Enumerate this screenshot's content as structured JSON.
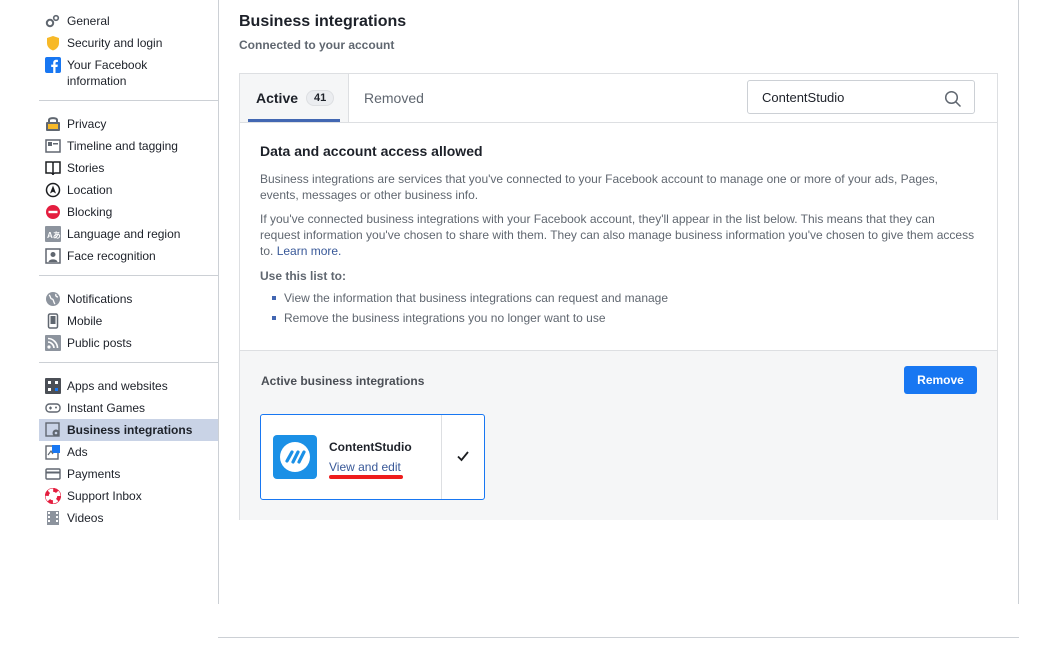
{
  "sidebar": {
    "groups": [
      [
        {
          "label": "General",
          "icon": "gears-icon"
        },
        {
          "label": "Security and login",
          "icon": "shield-icon"
        },
        {
          "label": "Your Facebook information",
          "icon": "facebook-icon"
        }
      ],
      [
        {
          "label": "Privacy",
          "icon": "lock-icon"
        },
        {
          "label": "Timeline and tagging",
          "icon": "timeline-icon"
        },
        {
          "label": "Stories",
          "icon": "book-icon"
        },
        {
          "label": "Location",
          "icon": "location-icon"
        },
        {
          "label": "Blocking",
          "icon": "blocking-icon"
        },
        {
          "label": "Language and region",
          "icon": "language-icon"
        },
        {
          "label": "Face recognition",
          "icon": "face-recognition-icon"
        }
      ],
      [
        {
          "label": "Notifications",
          "icon": "globe-icon"
        },
        {
          "label": "Mobile",
          "icon": "mobile-icon"
        },
        {
          "label": "Public posts",
          "icon": "rss-icon"
        }
      ],
      [
        {
          "label": "Apps and websites",
          "icon": "apps-icon"
        },
        {
          "label": "Instant Games",
          "icon": "gamepad-icon"
        },
        {
          "label": "Business integrations",
          "icon": "business-integrations-icon",
          "active": true
        },
        {
          "label": "Ads",
          "icon": "ads-icon"
        },
        {
          "label": "Payments",
          "icon": "payments-icon"
        },
        {
          "label": "Support Inbox",
          "icon": "lifebuoy-icon"
        },
        {
          "label": "Videos",
          "icon": "film-icon"
        }
      ]
    ]
  },
  "header": {
    "title": "Business integrations",
    "subtitle": "Connected to your account"
  },
  "tabs": {
    "active_label": "Active",
    "active_count": "41",
    "removed_label": "Removed"
  },
  "search": {
    "value": "ContentStudio",
    "icon": "search-icon"
  },
  "info": {
    "heading": "Data and account access allowed",
    "paragraph1": "Business integrations are services that you've connected to your Facebook account to manage one or more of your ads, Pages, events, messages or other business info.",
    "paragraph2": "If you've connected business integrations with your Facebook account, they'll appear in the list below. This means that they can request information you've chosen to share with them. They can also manage business information you've chosen to give them access to.",
    "learn_more": "Learn more.",
    "use_list_title": "Use this list to:",
    "bullets": [
      "View the information that business integrations can request and manage",
      "Remove the business integrations you no longer want to use"
    ]
  },
  "active_section": {
    "title": "Active business integrations",
    "remove_label": "Remove",
    "integration": {
      "name": "ContentStudio",
      "link": "View and edit",
      "checked": true
    }
  },
  "colors": {
    "accent": "#1877f2",
    "link": "#385898",
    "active_nav_bg": "#c9d3e6",
    "annotation": "#ee1c1c"
  }
}
